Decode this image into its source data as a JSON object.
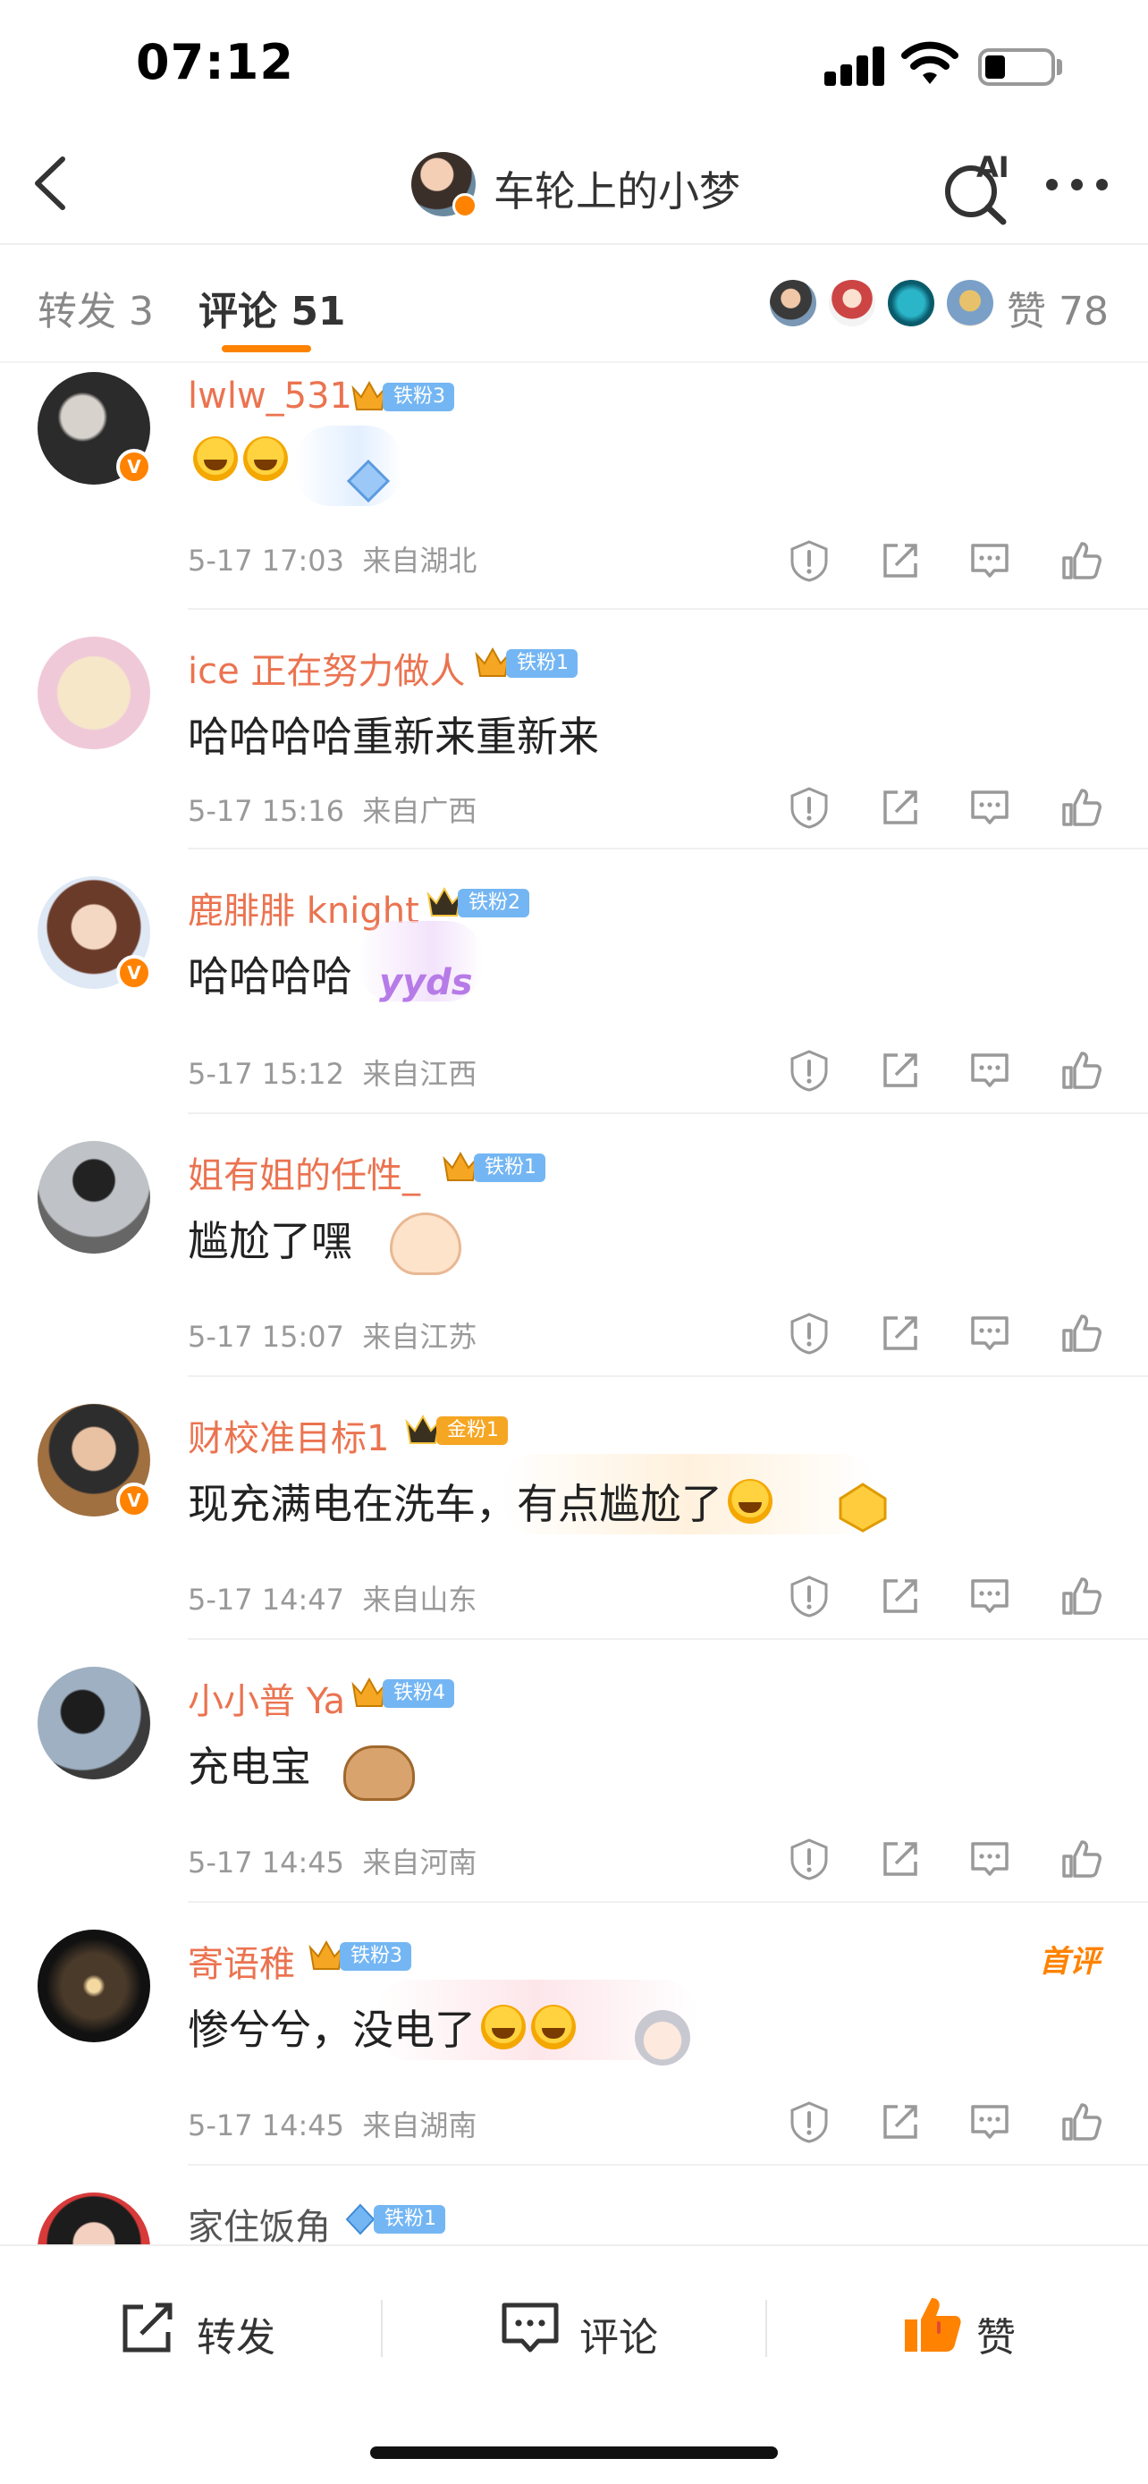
{
  "status_bar": {
    "time": "07:12"
  },
  "nav": {
    "title": "车轮上的小梦",
    "ai_label": "AI"
  },
  "tabs": {
    "repost": "转发 3",
    "comment": "评论 51",
    "likes": "赞 78"
  },
  "comments": [
    {
      "name": "lwlw_531",
      "fan_badge": "铁粉3",
      "text": "",
      "emojis": 2,
      "time": "5-17 17:03",
      "location": "来自湖北",
      "first": ""
    },
    {
      "name": "ice 正在努力做人",
      "fan_badge": "铁粉1",
      "text": "哈哈哈哈重新来重新来",
      "emojis": 0,
      "time": "5-17 15:16",
      "location": "来自广西",
      "first": ""
    },
    {
      "name": "鹿腓腓 knight",
      "fan_badge": "铁粉2",
      "text": "哈哈哈哈",
      "emojis": 0,
      "deco_text": "yyds",
      "time": "5-17 15:12",
      "location": "来自江西",
      "first": ""
    },
    {
      "name": "姐有姐的任性_",
      "fan_badge": "铁粉1",
      "text": "尴尬了嘿",
      "emojis": 0,
      "time": "5-17 15:07",
      "location": "来自江苏",
      "first": ""
    },
    {
      "name": "财校准目标1",
      "fan_badge": "金粉1",
      "text": "现充满电在洗车，有点尴尬了",
      "emojis": 1,
      "time": "5-17 14:47",
      "location": "来自山东",
      "first": ""
    },
    {
      "name": "小小普 Ya",
      "fan_badge": "铁粉4",
      "text": "充电宝",
      "emojis": 0,
      "time": "5-17 14:45",
      "location": "来自河南",
      "first": ""
    },
    {
      "name": "寄语稚",
      "fan_badge": "铁粉3",
      "text": "惨兮兮，没电了",
      "emojis": 2,
      "time": "5-17 14:45",
      "location": "来自湖南",
      "first": "首评"
    },
    {
      "name": "家住饭角",
      "fan_badge": "铁粉1",
      "text": "",
      "emojis": 0,
      "time": "",
      "location": "",
      "first": ""
    }
  ],
  "toolbar": {
    "repost": "转发",
    "comment": "评论",
    "like": "赞"
  },
  "colors": {
    "accent": "#ff8200",
    "name": "#eb7350",
    "iron_badge": "#74b6f3",
    "gold_badge": "#f5a623"
  }
}
